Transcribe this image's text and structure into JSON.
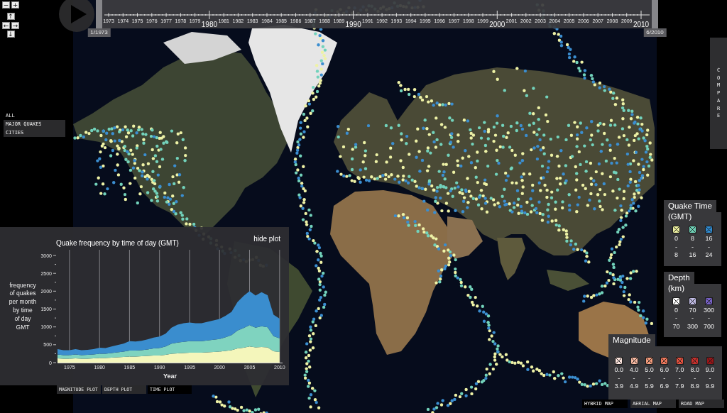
{
  "zoom_buttons": [
    {
      "label": "−"
    },
    {
      "label": "+"
    }
  ],
  "pan_buttons": [
    {
      "label": "↑",
      "kind": "up"
    },
    {
      "label": "←",
      "kind": "left"
    },
    {
      "label": "→",
      "kind": "right"
    },
    {
      "label": "↓",
      "kind": "down"
    }
  ],
  "timeline": {
    "ticks": [
      {
        "label": "1973",
        "kind": "minor"
      },
      {
        "label": "1974",
        "kind": "minor"
      },
      {
        "label": "1975",
        "kind": "minor"
      },
      {
        "label": "1976",
        "kind": "minor"
      },
      {
        "label": "1977",
        "kind": "minor"
      },
      {
        "label": "1978",
        "kind": "minor"
      },
      {
        "label": "1979",
        "kind": "minor"
      },
      {
        "label": "1980",
        "kind": "major"
      },
      {
        "label": "1981",
        "kind": "minor"
      },
      {
        "label": "1982",
        "kind": "minor"
      },
      {
        "label": "1983",
        "kind": "minor"
      },
      {
        "label": "1984",
        "kind": "minor"
      },
      {
        "label": "1985",
        "kind": "minor"
      },
      {
        "label": "1986",
        "kind": "minor"
      },
      {
        "label": "1987",
        "kind": "minor"
      },
      {
        "label": "1988",
        "kind": "minor"
      },
      {
        "label": "1989",
        "kind": "minor"
      },
      {
        "label": "1990",
        "kind": "major"
      },
      {
        "label": "1991",
        "kind": "minor"
      },
      {
        "label": "1992",
        "kind": "minor"
      },
      {
        "label": "1993",
        "kind": "minor"
      },
      {
        "label": "1994",
        "kind": "minor"
      },
      {
        "label": "1995",
        "kind": "minor"
      },
      {
        "label": "1996",
        "kind": "minor"
      },
      {
        "label": "1997",
        "kind": "minor"
      },
      {
        "label": "1998",
        "kind": "minor"
      },
      {
        "label": "1999",
        "kind": "minor"
      },
      {
        "label": "2000",
        "kind": "major"
      },
      {
        "label": "2001",
        "kind": "minor"
      },
      {
        "label": "2002",
        "kind": "minor"
      },
      {
        "label": "2003",
        "kind": "minor"
      },
      {
        "label": "2004",
        "kind": "minor"
      },
      {
        "label": "2005",
        "kind": "minor"
      },
      {
        "label": "2006",
        "kind": "minor"
      },
      {
        "label": "2007",
        "kind": "minor"
      },
      {
        "label": "2008",
        "kind": "minor"
      },
      {
        "label": "2009",
        "kind": "minor"
      },
      {
        "label": "2010",
        "kind": "major"
      }
    ],
    "handles": [
      {
        "label": "1/1973",
        "level": 0
      },
      {
        "label": "6/2010",
        "level": 1
      }
    ]
  },
  "layer_menu": [
    {
      "label": "ALL",
      "selected": true
    },
    {
      "label": "MAJOR QUAKES",
      "selected": false
    },
    {
      "label": "CITIES",
      "selected": false
    }
  ],
  "compare_button": {
    "label": "COMPARE"
  },
  "legends": [
    {
      "title": "Quake Time",
      "subtitle": "(GMT)",
      "items": [
        {
          "color": "#eef1a0",
          "lines": [
            "0",
            "-",
            "8"
          ]
        },
        {
          "color": "#70d3b8",
          "lines": [
            "8",
            "-",
            "16"
          ]
        },
        {
          "color": "#2f8ad0",
          "lines": [
            "16",
            "-",
            "24"
          ]
        }
      ]
    },
    {
      "title": "Depth",
      "subtitle": "(km)",
      "items": [
        {
          "color": "#ffffff",
          "lines": [
            "0",
            "-",
            "70"
          ]
        },
        {
          "color": "#c2bde6",
          "lines": [
            "70",
            "-",
            "300"
          ]
        },
        {
          "color": "#7660c4",
          "lines": [
            "300",
            "-",
            "700"
          ]
        }
      ]
    },
    {
      "title": "Magnitude",
      "items": [
        {
          "color": "#fbe3dc",
          "lines": [
            "0.0",
            "-",
            "3.9"
          ]
        },
        {
          "color": "#f7b9a2",
          "lines": [
            "4.0",
            "-",
            "4.9"
          ]
        },
        {
          "color": "#f59c7c",
          "lines": [
            "5.0",
            "-",
            "5.9"
          ]
        },
        {
          "color": "#f0785c",
          "lines": [
            "6.0",
            "-",
            "6.9"
          ]
        },
        {
          "color": "#e4503e",
          "lines": [
            "7.0",
            "-",
            "7.9"
          ]
        },
        {
          "color": "#c8302c",
          "lines": [
            "8.0",
            "-",
            "8.9"
          ]
        },
        {
          "color": "#9a1518",
          "lines": [
            "9.0",
            "-",
            "9.9"
          ]
        }
      ]
    }
  ],
  "plot": {
    "hide_label": "hide plot",
    "chart_data": {
      "type": "area",
      "title": "Quake frequency by time of day (GMT)",
      "xlabel": "Year",
      "ylabel": "frequency of quakes per month by time of day GMT",
      "x": [
        1973,
        1974,
        1975,
        1976,
        1977,
        1978,
        1979,
        1980,
        1981,
        1982,
        1983,
        1984,
        1985,
        1986,
        1987,
        1988,
        1989,
        1990,
        1991,
        1992,
        1993,
        1994,
        1995,
        1996,
        1997,
        1998,
        1999,
        2000,
        2001,
        2002,
        2003,
        2004,
        2005,
        2006,
        2007,
        2008,
        2009,
        2010
      ],
      "series": [
        {
          "color": "#f4f6bb",
          "values": [
            120,
            110,
            110,
            120,
            110,
            110,
            120,
            130,
            130,
            140,
            150,
            160,
            170,
            170,
            180,
            190,
            200,
            200,
            220,
            250,
            260,
            270,
            280,
            280,
            280,
            290,
            300,
            310,
            330,
            350,
            400,
            420,
            450,
            430,
            440,
            430,
            320,
            300
          ]
        },
        {
          "color": "#7fd3bf",
          "values": [
            110,
            100,
            100,
            110,
            100,
            110,
            110,
            120,
            120,
            130,
            140,
            150,
            170,
            170,
            170,
            180,
            200,
            210,
            230,
            280,
            300,
            310,
            320,
            320,
            320,
            330,
            340,
            350,
            380,
            420,
            500,
            550,
            600,
            550,
            580,
            560,
            420,
            380
          ]
        },
        {
          "color": "#3a8dce",
          "values": [
            150,
            140,
            140,
            150,
            140,
            140,
            150,
            170,
            160,
            180,
            200,
            220,
            260,
            250,
            260,
            280,
            300,
            320,
            360,
            450,
            500,
            520,
            520,
            500,
            500,
            520,
            540,
            560,
            600,
            650,
            800,
            900,
            950,
            900,
            950,
            900,
            600,
            550
          ]
        }
      ],
      "xlim": [
        1973,
        2010.5
      ],
      "ylim": [
        0,
        3000
      ],
      "xticks": [
        1975,
        1980,
        1985,
        1990,
        1995,
        2000,
        2005,
        2010
      ],
      "yticks": [
        0,
        500,
        1000,
        1500,
        2000,
        2500,
        3000
      ],
      "stacked": true,
      "grid": true
    }
  },
  "plot_tabs": [
    {
      "label": "MAGNITUDE PLOT",
      "selected": false
    },
    {
      "label": "DEPTH PLOT",
      "selected": false
    },
    {
      "label": "TIME PLOT",
      "selected": true
    }
  ],
  "map_types": [
    {
      "label": "HYBRID MAP",
      "selected": true
    },
    {
      "label": "AERIAL MAP",
      "selected": false
    },
    {
      "label": "ROAD MAP",
      "selected": false
    }
  ]
}
